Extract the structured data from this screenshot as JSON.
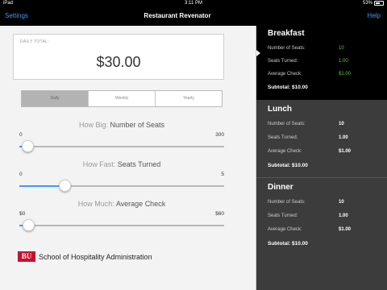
{
  "status": {
    "device": "iPad",
    "time": "3:11 PM",
    "battery": "53%"
  },
  "nav": {
    "left": "Settings",
    "title": "Restaurant Revenator",
    "right": "Help"
  },
  "summary": {
    "label": "DAILY TOTAL:",
    "value": "$30.00"
  },
  "period_tabs": [
    {
      "label": "Daily",
      "active": true
    },
    {
      "label": "Weekly",
      "active": false
    },
    {
      "label": "Yearly",
      "active": false
    }
  ],
  "sliders": [
    {
      "prefix": "How Big:",
      "label": "Number of Seats",
      "min": "0",
      "max": "300",
      "level": 0.04
    },
    {
      "prefix": "How Fast:",
      "label": "Seats Turned",
      "min": "0",
      "max": "5",
      "level": 0.22
    },
    {
      "prefix": "How Much:",
      "label": "Average Check",
      "min": "$0",
      "max": "$60",
      "level": 0.045
    }
  ],
  "footer": {
    "logo": "BU",
    "school": "School of Hospitality Administration"
  },
  "meals": [
    {
      "title": "Breakfast",
      "selected": true,
      "rows": [
        {
          "label": "Number of Seats:",
          "value": "10"
        },
        {
          "label": "Seats Turned:",
          "value": "1.00"
        },
        {
          "label": "Average Check:",
          "value": "$1.00"
        }
      ],
      "subtotal": "Subtotal: $10.00"
    },
    {
      "title": "Lunch",
      "selected": false,
      "rows": [
        {
          "label": "Number of Seats:",
          "value": "10"
        },
        {
          "label": "Seats Turned:",
          "value": "1.00"
        },
        {
          "label": "Average Check:",
          "value": "$1.00"
        }
      ],
      "subtotal": "Subtotal: $10.00"
    },
    {
      "title": "Dinner",
      "selected": false,
      "rows": [
        {
          "label": "Number of Seats:",
          "value": "10"
        },
        {
          "label": "Seats Turned:",
          "value": "1.00"
        },
        {
          "label": "Average Check:",
          "value": "$1.00"
        }
      ],
      "subtotal": "Subtotal: $10.00"
    }
  ],
  "colors": {
    "accent": "#3a9bff",
    "highlight_value": "#5fcf2f",
    "brand": "#c8102e"
  }
}
